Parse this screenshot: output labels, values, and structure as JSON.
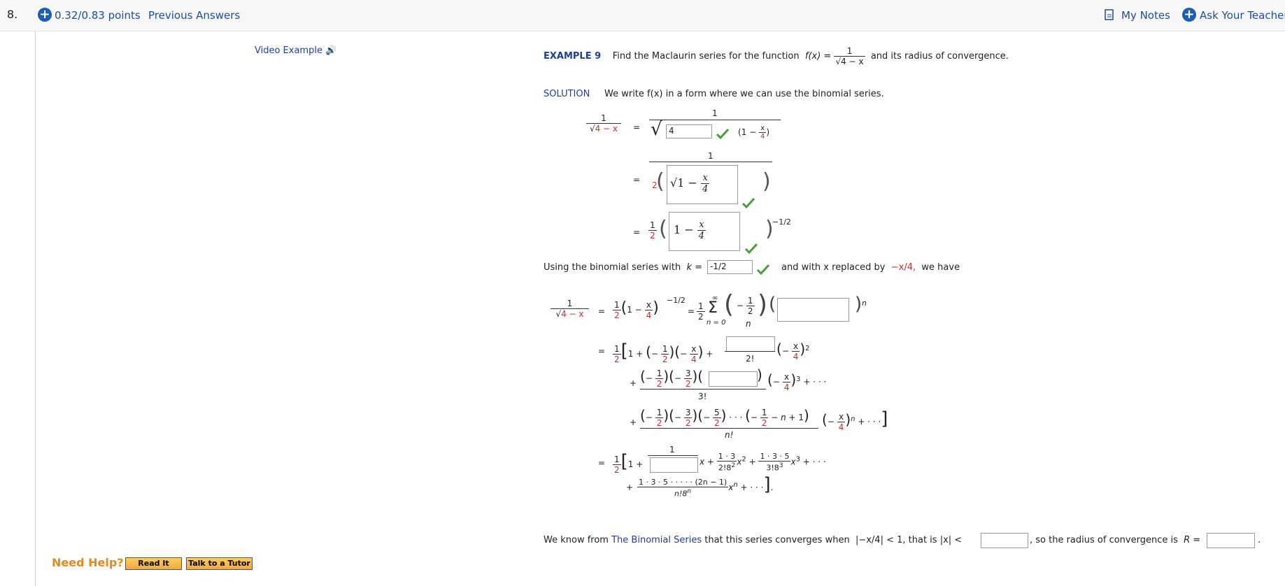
{
  "header": {
    "question_number": "8.",
    "points": "0.32/0.83 points",
    "previous_answers": "Previous Answers",
    "my_notes": "My Notes",
    "ask_teacher": "Ask Your Teacher"
  },
  "video_example": "Video Example",
  "example": {
    "label": "EXAMPLE 9",
    "text": "Find the Maclaurin series for the function",
    "fx": "f(x) =",
    "frac_num": "1",
    "frac_den": "4 − x",
    "tail": "and its radius of convergence."
  },
  "solution": {
    "label": "SOLUTION",
    "text": "We write f(x) in a form where we can use the binomial series."
  },
  "step1": {
    "answer_value": "4",
    "inner": "1 − ",
    "x_over_4_num": "x",
    "x_over_4_den": "4"
  },
  "step2": {
    "coef": "2",
    "box_text": "1 − ",
    "x": "x",
    "four": "4"
  },
  "step3": {
    "half_num": "1",
    "half_den": "2",
    "box_text": "1 − ",
    "x": "x",
    "four": "4",
    "exponent": "−1/2"
  },
  "binomial": {
    "prefix": "Using the binomial series with",
    "k_label": "k =",
    "k_value": "-1/2",
    "mid": "and with x replaced by",
    "replace": "−x/4,",
    "suffix": "we have"
  },
  "series": {
    "exp_half": "−1/2",
    "sum_top": "∞",
    "sum_bottom": "n = 0",
    "n": "n",
    "two_fact": "2!",
    "three_fact": "3!",
    "n_fact": "n!",
    "dots": "+ · · ·",
    "term_1_3": "1 · 3",
    "den_2_8": "2!8",
    "term_1_3_5": "1 · 3 · 5",
    "den_3_8": "3!8",
    "general_num": "1 · 3 · 5 · · · · · (2n − 1)",
    "general_den": "n!8"
  },
  "conclusion": {
    "prefix": "We know from",
    "link": "The Binomial Series",
    "mid": "that this series converges when",
    "cond": "|−x/4| < 1,  that is  |x| <",
    "radius": ", so the radius of convergence is",
    "R": "R ="
  },
  "help": {
    "label": "Need Help?",
    "read_it": "Read It",
    "tutor": "Talk to a Tutor"
  }
}
